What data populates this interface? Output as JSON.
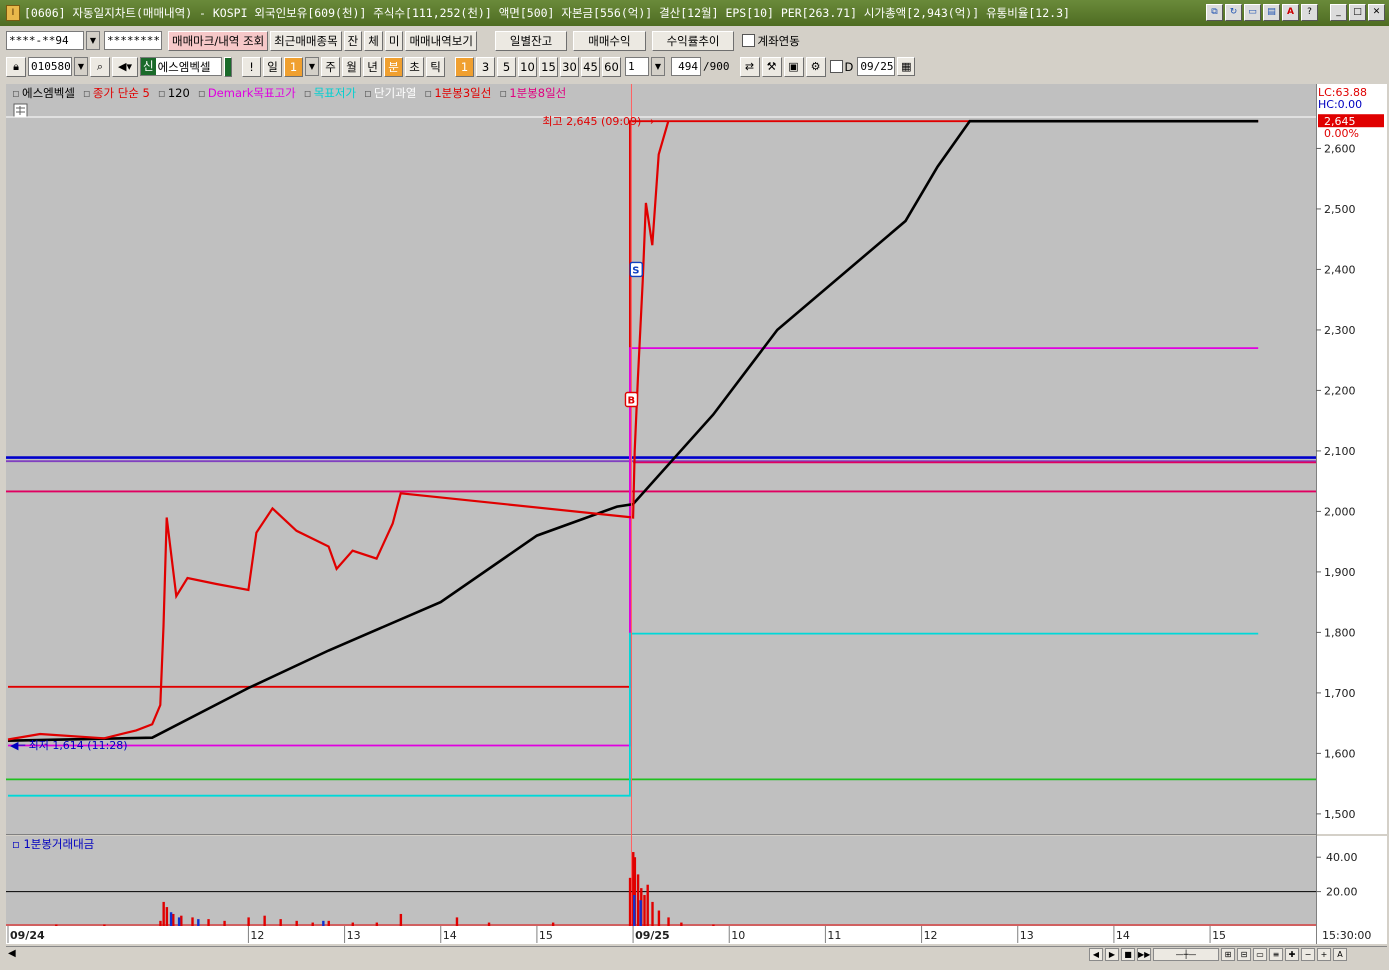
{
  "window": {
    "title": "[0606] 자동일지차트(매매내역) - KOSPI 외국인보유[609(천)] 주식수[111,252(천)] 액면[500] 자본금[556(억)] 결산[12월] EPS[10] PER[263.71] 시가총액[2,943(억)] 유통비율[12.3]",
    "app_icon": "I"
  },
  "toolbar1": {
    "account": "****-**94",
    "password": "*********",
    "btn_trade_mark": "매매마크/내역 조회",
    "btn_recent": "최근매매종목",
    "btn_jan": "잔",
    "btn_che": "체",
    "btn_mi": "미",
    "btn_history": "매매내역보기",
    "btn_daily_balance": "일별잔고",
    "btn_trade_profit": "매매수익",
    "btn_return_trend": "수익률추이",
    "chk_account_link": "계좌연동"
  },
  "toolbar2": {
    "code": "010580",
    "stock_badge": "신",
    "stock_name": "에스엠벡셀",
    "btn_excl": "!",
    "period_buttons": [
      "일",
      "1",
      "주",
      "월",
      "년",
      "분",
      "초",
      "틱"
    ],
    "interval_buttons": [
      "1",
      "3",
      "5",
      "10",
      "15",
      "30",
      "45",
      "60"
    ],
    "interval_value": "1",
    "count": "494",
    "count_max": "/900",
    "date_label": "D",
    "date": "09/25"
  },
  "chart_data": {
    "type": "line",
    "legend": [
      {
        "text": "에스엠벡셀",
        "color": "#000000"
      },
      {
        "text": "종가 단순 5",
        "color": "#e00000"
      },
      {
        "text": "120",
        "color": "#000000"
      },
      {
        "text": "Demark목표고가",
        "color": "#e000e0"
      },
      {
        "text": "목표저가",
        "color": "#00d0d0"
      },
      {
        "text": "단기과열",
        "color": "#ffffff"
      },
      {
        "text": "1분봉3일선",
        "color": "#e00000"
      },
      {
        "text": "1분봉8일선",
        "color": "#e00080"
      }
    ],
    "lc_label": "LC:63.88",
    "hc_label": "HC:0.00",
    "current_price": "2,645",
    "current_pct": "0.00%",
    "high_label": "최고 2,645 (09:09)",
    "low_label": "최저 1,614 (11:28)",
    "ylim": [
      1475,
      2690
    ],
    "y_ticks": [
      "2,600",
      "2,500",
      "2,400",
      "2,300",
      "2,200",
      "2,100",
      "2,000",
      "1,900",
      "1,800",
      "1,700",
      "1,600",
      "1,500"
    ],
    "y_tick_values": [
      2600,
      2500,
      2400,
      2300,
      2200,
      2100,
      2000,
      1900,
      1800,
      1700,
      1600,
      1500
    ],
    "x_ticks": [
      "09/24",
      "12",
      "13",
      "14",
      "15",
      "09/25",
      "10",
      "11",
      "12",
      "13",
      "14",
      "15"
    ],
    "x_tick_times": [
      0,
      150,
      210,
      270,
      330,
      390,
      450,
      510,
      570,
      630,
      690,
      750
    ],
    "x_total_minutes": 798,
    "reference_lines": [
      {
        "name": "blue-line",
        "value": 2089,
        "color": "#0000cc"
      },
      {
        "name": "purple-line",
        "value": 2083,
        "color": "#8040c0"
      },
      {
        "name": "short-pink-line",
        "value": 2081,
        "color": "#e00060",
        "from": 390
      },
      {
        "name": "pink-line",
        "value": 2033,
        "color": "#e00060"
      },
      {
        "name": "green-line",
        "value": 1557,
        "color": "#20c020"
      }
    ],
    "step_lines": [
      {
        "name": "red-3day",
        "color": "#e00000",
        "points": [
          [
            0,
            1710
          ],
          [
            388,
            1710
          ],
          [
            388,
            2645
          ],
          [
            798,
            2645
          ]
        ]
      },
      {
        "name": "demark-high",
        "color": "#e000e0",
        "points": [
          [
            0,
            1613
          ],
          [
            388,
            1613
          ],
          [
            388,
            2270
          ],
          [
            798,
            2270
          ]
        ]
      },
      {
        "name": "demark-low",
        "color": "#00d8d8",
        "points": [
          [
            0,
            1530
          ],
          [
            388,
            1530
          ],
          [
            388,
            1798
          ],
          [
            798,
            1798
          ]
        ]
      }
    ],
    "ma120": [
      [
        0,
        1621
      ],
      [
        90,
        1626
      ],
      [
        150,
        1708
      ],
      [
        200,
        1770
      ],
      [
        270,
        1850
      ],
      [
        330,
        1960
      ],
      [
        380,
        2008
      ],
      [
        390,
        2012
      ],
      [
        440,
        2160
      ],
      [
        480,
        2300
      ],
      [
        560,
        2480
      ],
      [
        580,
        2570
      ],
      [
        600,
        2645
      ],
      [
        798,
        2645
      ]
    ],
    "price": [
      [
        0,
        1623
      ],
      [
        20,
        1632
      ],
      [
        60,
        1625
      ],
      [
        80,
        1638
      ],
      [
        90,
        1648
      ],
      [
        95,
        1680
      ],
      [
        97,
        1810
      ],
      [
        99,
        1990
      ],
      [
        105,
        1860
      ],
      [
        112,
        1890
      ],
      [
        130,
        1880
      ],
      [
        150,
        1870
      ],
      [
        155,
        1965
      ],
      [
        165,
        2005
      ],
      [
        180,
        1968
      ],
      [
        200,
        1942
      ],
      [
        205,
        1905
      ],
      [
        215,
        1935
      ],
      [
        230,
        1922
      ],
      [
        240,
        1980
      ],
      [
        245,
        2030
      ],
      [
        390,
        1990
      ],
      [
        391,
        2100
      ],
      [
        393,
        2220
      ],
      [
        396,
        2380
      ],
      [
        398,
        2510
      ],
      [
        402,
        2440
      ],
      [
        406,
        2590
      ],
      [
        412,
        2645
      ]
    ],
    "buy_marker": {
      "label": "B",
      "x": 389,
      "value": 2185
    },
    "sell_marker": {
      "label": "S",
      "x": 392,
      "value": 2400
    },
    "volume": {
      "title": "1분봉거래대금",
      "ylim": [
        0,
        50
      ],
      "y_ticks": [
        "40.00",
        "20.00"
      ],
      "y_tick_values": [
        40,
        20
      ],
      "ref_value": 20,
      "bars": [
        [
          30,
          1
        ],
        [
          60,
          1
        ],
        [
          95,
          3
        ],
        [
          97,
          14
        ],
        [
          99,
          11
        ],
        [
          103,
          7
        ],
        [
          108,
          6
        ],
        [
          115,
          5
        ],
        [
          125,
          4
        ],
        [
          135,
          3
        ],
        [
          150,
          5
        ],
        [
          160,
          6
        ],
        [
          170,
          4
        ],
        [
          180,
          3
        ],
        [
          190,
          2
        ],
        [
          200,
          3
        ],
        [
          215,
          2
        ],
        [
          230,
          2
        ],
        [
          245,
          7
        ],
        [
          280,
          5
        ],
        [
          300,
          2
        ],
        [
          340,
          2
        ],
        [
          388,
          28
        ],
        [
          390,
          43
        ],
        [
          391,
          40
        ],
        [
          393,
          30
        ],
        [
          395,
          22
        ],
        [
          397,
          18
        ],
        [
          399,
          24
        ],
        [
          402,
          14
        ],
        [
          406,
          9
        ],
        [
          412,
          5
        ],
        [
          420,
          2
        ],
        [
          440,
          1
        ]
      ],
      "blue_bars": [
        [
          101,
          8
        ],
        [
          106,
          5
        ],
        [
          118,
          4
        ],
        [
          196,
          3
        ],
        [
          390,
          18
        ],
        [
          394,
          15
        ]
      ]
    },
    "time_label": "15:30:00"
  }
}
